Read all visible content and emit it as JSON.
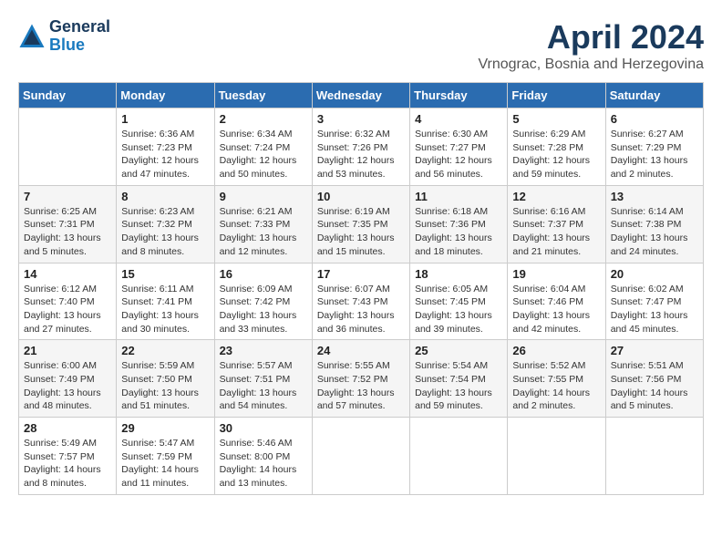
{
  "header": {
    "logo_general": "General",
    "logo_blue": "Blue",
    "month_title": "April 2024",
    "location": "Vrnograc, Bosnia and Herzegovina"
  },
  "weekdays": [
    "Sunday",
    "Monday",
    "Tuesday",
    "Wednesday",
    "Thursday",
    "Friday",
    "Saturday"
  ],
  "weeks": [
    [
      {
        "day": "",
        "info": ""
      },
      {
        "day": "1",
        "info": "Sunrise: 6:36 AM\nSunset: 7:23 PM\nDaylight: 12 hours\nand 47 minutes."
      },
      {
        "day": "2",
        "info": "Sunrise: 6:34 AM\nSunset: 7:24 PM\nDaylight: 12 hours\nand 50 minutes."
      },
      {
        "day": "3",
        "info": "Sunrise: 6:32 AM\nSunset: 7:26 PM\nDaylight: 12 hours\nand 53 minutes."
      },
      {
        "day": "4",
        "info": "Sunrise: 6:30 AM\nSunset: 7:27 PM\nDaylight: 12 hours\nand 56 minutes."
      },
      {
        "day": "5",
        "info": "Sunrise: 6:29 AM\nSunset: 7:28 PM\nDaylight: 12 hours\nand 59 minutes."
      },
      {
        "day": "6",
        "info": "Sunrise: 6:27 AM\nSunset: 7:29 PM\nDaylight: 13 hours\nand 2 minutes."
      }
    ],
    [
      {
        "day": "7",
        "info": "Sunrise: 6:25 AM\nSunset: 7:31 PM\nDaylight: 13 hours\nand 5 minutes."
      },
      {
        "day": "8",
        "info": "Sunrise: 6:23 AM\nSunset: 7:32 PM\nDaylight: 13 hours\nand 8 minutes."
      },
      {
        "day": "9",
        "info": "Sunrise: 6:21 AM\nSunset: 7:33 PM\nDaylight: 13 hours\nand 12 minutes."
      },
      {
        "day": "10",
        "info": "Sunrise: 6:19 AM\nSunset: 7:35 PM\nDaylight: 13 hours\nand 15 minutes."
      },
      {
        "day": "11",
        "info": "Sunrise: 6:18 AM\nSunset: 7:36 PM\nDaylight: 13 hours\nand 18 minutes."
      },
      {
        "day": "12",
        "info": "Sunrise: 6:16 AM\nSunset: 7:37 PM\nDaylight: 13 hours\nand 21 minutes."
      },
      {
        "day": "13",
        "info": "Sunrise: 6:14 AM\nSunset: 7:38 PM\nDaylight: 13 hours\nand 24 minutes."
      }
    ],
    [
      {
        "day": "14",
        "info": "Sunrise: 6:12 AM\nSunset: 7:40 PM\nDaylight: 13 hours\nand 27 minutes."
      },
      {
        "day": "15",
        "info": "Sunrise: 6:11 AM\nSunset: 7:41 PM\nDaylight: 13 hours\nand 30 minutes."
      },
      {
        "day": "16",
        "info": "Sunrise: 6:09 AM\nSunset: 7:42 PM\nDaylight: 13 hours\nand 33 minutes."
      },
      {
        "day": "17",
        "info": "Sunrise: 6:07 AM\nSunset: 7:43 PM\nDaylight: 13 hours\nand 36 minutes."
      },
      {
        "day": "18",
        "info": "Sunrise: 6:05 AM\nSunset: 7:45 PM\nDaylight: 13 hours\nand 39 minutes."
      },
      {
        "day": "19",
        "info": "Sunrise: 6:04 AM\nSunset: 7:46 PM\nDaylight: 13 hours\nand 42 minutes."
      },
      {
        "day": "20",
        "info": "Sunrise: 6:02 AM\nSunset: 7:47 PM\nDaylight: 13 hours\nand 45 minutes."
      }
    ],
    [
      {
        "day": "21",
        "info": "Sunrise: 6:00 AM\nSunset: 7:49 PM\nDaylight: 13 hours\nand 48 minutes."
      },
      {
        "day": "22",
        "info": "Sunrise: 5:59 AM\nSunset: 7:50 PM\nDaylight: 13 hours\nand 51 minutes."
      },
      {
        "day": "23",
        "info": "Sunrise: 5:57 AM\nSunset: 7:51 PM\nDaylight: 13 hours\nand 54 minutes."
      },
      {
        "day": "24",
        "info": "Sunrise: 5:55 AM\nSunset: 7:52 PM\nDaylight: 13 hours\nand 57 minutes."
      },
      {
        "day": "25",
        "info": "Sunrise: 5:54 AM\nSunset: 7:54 PM\nDaylight: 13 hours\nand 59 minutes."
      },
      {
        "day": "26",
        "info": "Sunrise: 5:52 AM\nSunset: 7:55 PM\nDaylight: 14 hours\nand 2 minutes."
      },
      {
        "day": "27",
        "info": "Sunrise: 5:51 AM\nSunset: 7:56 PM\nDaylight: 14 hours\nand 5 minutes."
      }
    ],
    [
      {
        "day": "28",
        "info": "Sunrise: 5:49 AM\nSunset: 7:57 PM\nDaylight: 14 hours\nand 8 minutes."
      },
      {
        "day": "29",
        "info": "Sunrise: 5:47 AM\nSunset: 7:59 PM\nDaylight: 14 hours\nand 11 minutes."
      },
      {
        "day": "30",
        "info": "Sunrise: 5:46 AM\nSunset: 8:00 PM\nDaylight: 14 hours\nand 13 minutes."
      },
      {
        "day": "",
        "info": ""
      },
      {
        "day": "",
        "info": ""
      },
      {
        "day": "",
        "info": ""
      },
      {
        "day": "",
        "info": ""
      }
    ]
  ]
}
